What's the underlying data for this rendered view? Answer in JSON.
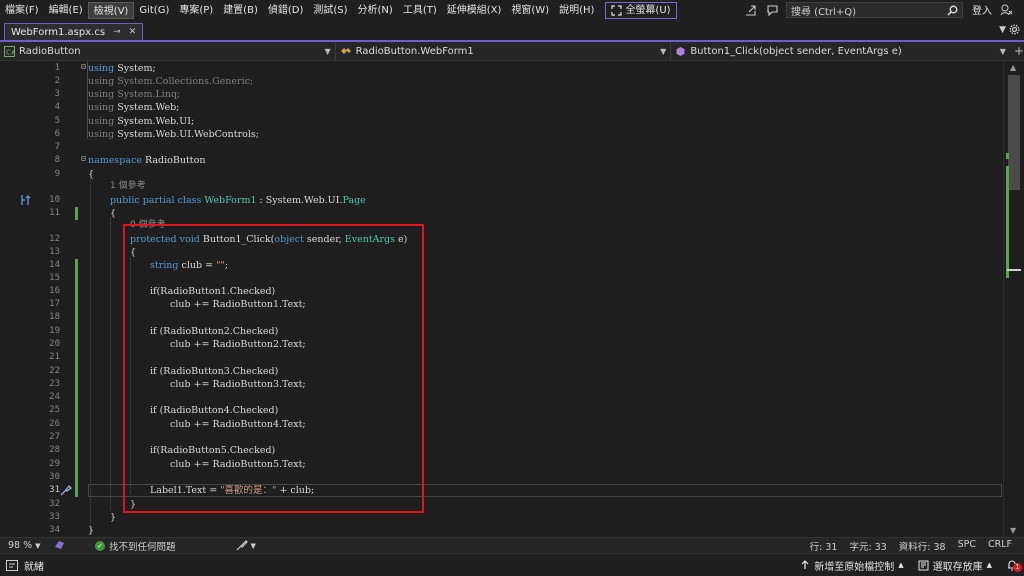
{
  "menu": {
    "items": [
      "檔案(F)",
      "編輯(E)",
      "檢視(V)",
      "Git(G)",
      "專案(P)",
      "建置(B)",
      "偵錯(D)",
      "測試(S)",
      "分析(N)",
      "工具(T)",
      "延伸模組(X)",
      "視窗(W)",
      "說明(H)"
    ],
    "active_index": 2,
    "fullscreen_label": "全螢幕(U)",
    "search_placeholder": "搜尋 (Ctrl+Q)",
    "signin_label": "登入"
  },
  "tab": {
    "title": "WebForm1.aspx.cs",
    "pin_glyph": "⊸",
    "close_glyph": "✕"
  },
  "nav": {
    "project": "RadioButton",
    "class": "RadioButton.WebForm1",
    "member": "Button1_Click(object sender, EventArgs e)"
  },
  "editor": {
    "line_numbers": [
      "1",
      "2",
      "3",
      "4",
      "5",
      "6",
      "7",
      "8",
      "9",
      "10",
      "11",
      "12",
      "13",
      "14",
      "15",
      "16",
      "17",
      "18",
      "19",
      "20",
      "21",
      "22",
      "23",
      "24",
      "25",
      "26",
      "27",
      "28",
      "29",
      "30",
      "31",
      "32",
      "33",
      "34"
    ],
    "current_line": "31",
    "codelens_class": "1 個參考",
    "codelens_method": "0 個參考",
    "lines": {
      "l1": "System;",
      "l2": "System.Collections.Generic;",
      "l3": "System.Linq;",
      "l4": "System.Web;",
      "l5": "System.Web.UI;",
      "l6": "System.Web.UI.WebControls;",
      "kw_using": "using",
      "kw_namespace": "namespace",
      "ns_name": " RadioButton",
      "brace_open": "{",
      "brace_close": "}",
      "kw_public": "public",
      "kw_partial": "partial",
      "kw_class": "class",
      "class_name": "WebForm1",
      "class_colon": " : System.Web.UI.",
      "class_base": "Page",
      "kw_protected": "protected",
      "kw_void": "void",
      "method_name": " Button1_Click(",
      "kw_object": "object",
      "param_sender": " sender, ",
      "ty_eventargs": "EventArgs",
      "param_e": " e)",
      "kw_string": "string",
      "decl_club": " club = ",
      "str_empty": "\"\"",
      "semi": ";",
      "if1": "if(RadioButton1.Checked)",
      "club1": "club += RadioButton1.Text;",
      "if2": "if (RadioButton2.Checked)",
      "club2": "club += RadioButton2.Text;",
      "if3": "if (RadioButton3.Checked)",
      "club3": "club += RadioButton3.Text;",
      "if4": "if (RadioButton4.Checked)",
      "club4": "club += RadioButton4.Text;",
      "if5": "if(RadioButton5.Checked)",
      "club5": "club += RadioButton5.Text;",
      "label_assign": "Label1.Text = ",
      "str_like": "\"喜歡的是：\"",
      "plus_club": " + club;"
    }
  },
  "editor_status": {
    "zoom": "98 %",
    "issues": "找不到任何問題",
    "line": "行: 31",
    "char": "字元: 33",
    "col": "資料行: 38",
    "spc": "SPC",
    "crlf": "CRLF"
  },
  "statusbar": {
    "ready": "就緒",
    "add_source": "新增至原始檔控制",
    "select_repo": "選取存放庫",
    "notif_count": "1"
  }
}
